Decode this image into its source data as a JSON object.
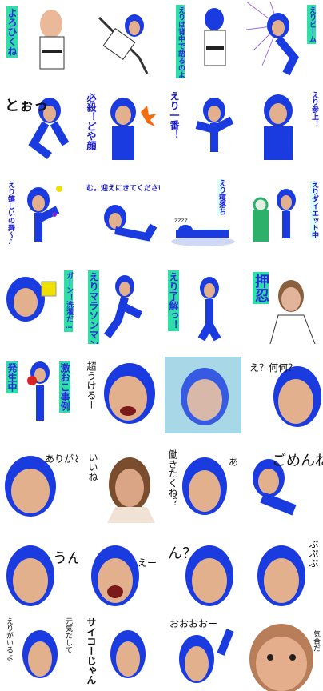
{
  "stickers": [
    {
      "id": 1,
      "text": "よろひくね",
      "style": "vertical-green"
    },
    {
      "id": 2,
      "text": "",
      "style": "none"
    },
    {
      "id": 3,
      "text": "えりは背中で語るのよ",
      "style": "vertical-green"
    },
    {
      "id": 4,
      "text": "えりビーム",
      "style": "vertical-green"
    },
    {
      "id": 5,
      "text": "とぉっ",
      "style": "horizontal"
    },
    {
      "id": 6,
      "text": "必殺！どや顔",
      "style": "vertical"
    },
    {
      "id": 7,
      "text": "えり一番！",
      "style": "vertical"
    },
    {
      "id": 8,
      "text": "えり参上！",
      "style": "vertical-small"
    },
    {
      "id": 9,
      "text": "えり嬉しいの舞〜♪",
      "style": "vertical-small"
    },
    {
      "id": 10,
      "text": "む。迎えにきてください",
      "style": "horizontal-small"
    },
    {
      "id": 11,
      "text": "えり寝落ち",
      "style": "vertical-small"
    },
    {
      "id": 12,
      "text": "えりダイエット中",
      "style": "vertical-small"
    },
    {
      "id": 13,
      "text": "ガーン！洗濯だ…",
      "style": "vertical-green-small"
    },
    {
      "id": 14,
      "text": "えりマラソンマン",
      "style": "vertical-green"
    },
    {
      "id": 15,
      "text": "えり了解っ！",
      "style": "vertical-green"
    },
    {
      "id": 16,
      "text": "押忍",
      "style": "vertical-green-big"
    },
    {
      "id": 17,
      "text": "発生中",
      "style": "vertical-green"
    },
    {
      "id": 18,
      "text": "激おこ事例",
      "style": "vertical-green"
    },
    {
      "id": 19,
      "text": "超うけるー",
      "style": "vertical-black"
    },
    {
      "id": 20,
      "text": "",
      "style": "none"
    },
    {
      "id": 21,
      "text": "え？何何？",
      "style": "horizontal-black"
    },
    {
      "id": 22,
      "text": "ありがと",
      "style": "horizontal-black"
    },
    {
      "id": 23,
      "text": "いいね",
      "style": "vertical-black"
    },
    {
      "id": 24,
      "text": "働きたくね？",
      "style": "vertical-black"
    },
    {
      "id": 25,
      "text": "あ",
      "style": "horizontal-black"
    },
    {
      "id": 26,
      "text": "ごめんね",
      "style": "horizontal-black"
    },
    {
      "id": 27,
      "text": "うん",
      "style": "horizontal-black"
    },
    {
      "id": 28,
      "text": "えー",
      "style": "horizontal-black"
    },
    {
      "id": 29,
      "text": "ん？",
      "style": "horizontal-black"
    },
    {
      "id": 30,
      "text": "ぷぷぷ",
      "style": "vertical-black"
    },
    {
      "id": 31,
      "text": "えりがいるよ",
      "style": "vertical-black"
    },
    {
      "id": 32,
      "text": "元気だして",
      "style": "vertical-black"
    },
    {
      "id": 33,
      "text": "サイコーじゃん",
      "style": "vertical-black"
    },
    {
      "id": 34,
      "text": "おおおおー",
      "style": "horizontal-black"
    },
    {
      "id": 35,
      "text": "気合だ",
      "style": "vertical-black"
    }
  ]
}
